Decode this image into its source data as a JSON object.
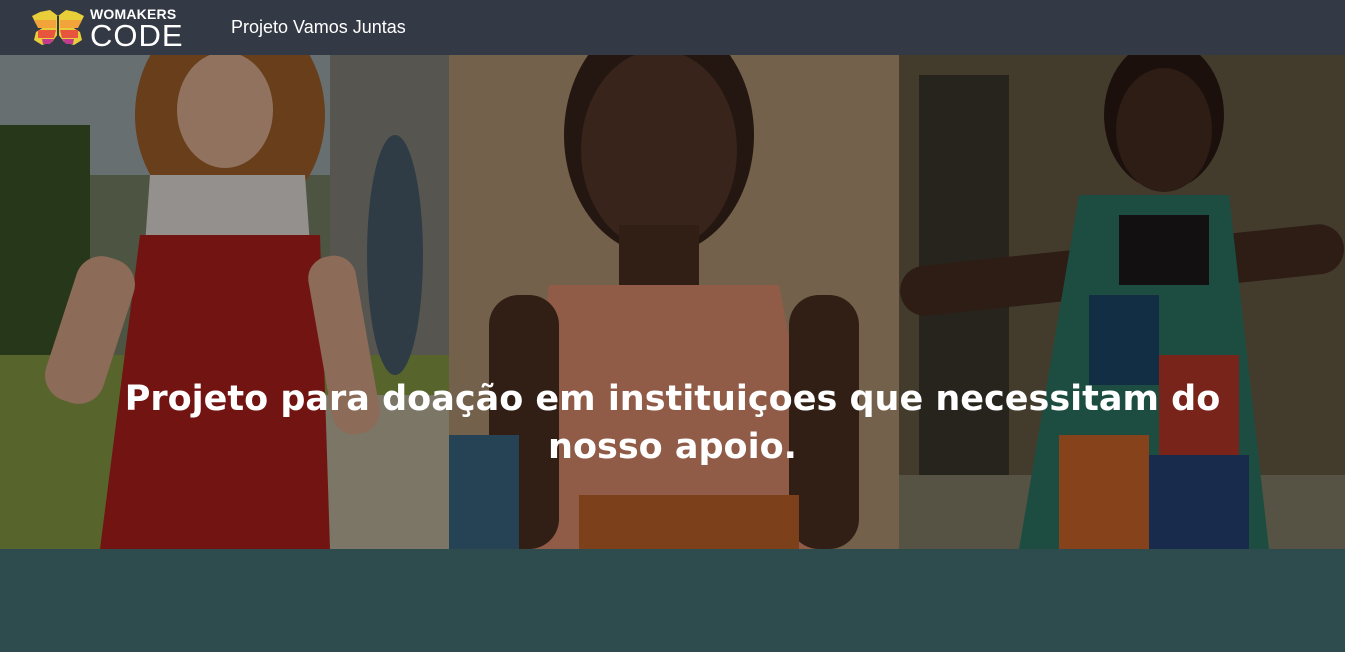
{
  "navbar": {
    "brand_top": "WOMAKERS",
    "brand_bottom": "CODE",
    "title": "Projeto Vamos Juntas"
  },
  "hero": {
    "title": "Projeto para doação em instituiçoes que necessitam do nosso apoio.",
    "images": [
      "girl-red-overalls-photo",
      "girl-peach-top-photo",
      "girl-patchwork-dress-photo"
    ]
  },
  "colors": {
    "navbar_bg": "#343a45",
    "page_bg": "#2e4c4e",
    "text": "#ffffff"
  }
}
